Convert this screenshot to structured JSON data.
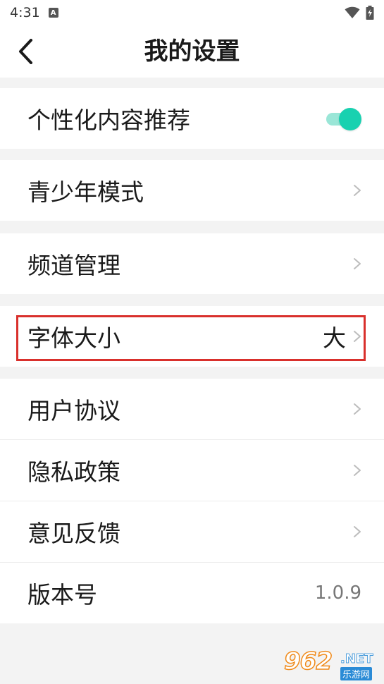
{
  "status_bar": {
    "time": "4:31",
    "notification_icon": "a-letter-icon",
    "signal_icon": "wifi-icon",
    "battery_icon": "battery-charging-icon"
  },
  "header": {
    "back_icon": "chevron-left-icon",
    "title": "我的设置"
  },
  "settings": {
    "personalized": {
      "label": "个性化内容推荐",
      "enabled": true
    },
    "youth_mode": {
      "label": "青少年模式"
    },
    "channel_manage": {
      "label": "频道管理"
    },
    "font_size": {
      "label": "字体大小",
      "value": "大"
    },
    "user_agreement": {
      "label": "用户协议"
    },
    "privacy_policy": {
      "label": "隐私政策"
    },
    "feedback": {
      "label": "意见反馈"
    },
    "version": {
      "label": "版本号",
      "value": "1.0.9"
    }
  },
  "watermark": {
    "logo": "962",
    "net": ".NET",
    "sub": "乐游网"
  },
  "colors": {
    "accent": "#18d1b0",
    "accent_track": "#9ae6d7",
    "highlight": "#d9302c",
    "background": "#f3f3f3"
  }
}
